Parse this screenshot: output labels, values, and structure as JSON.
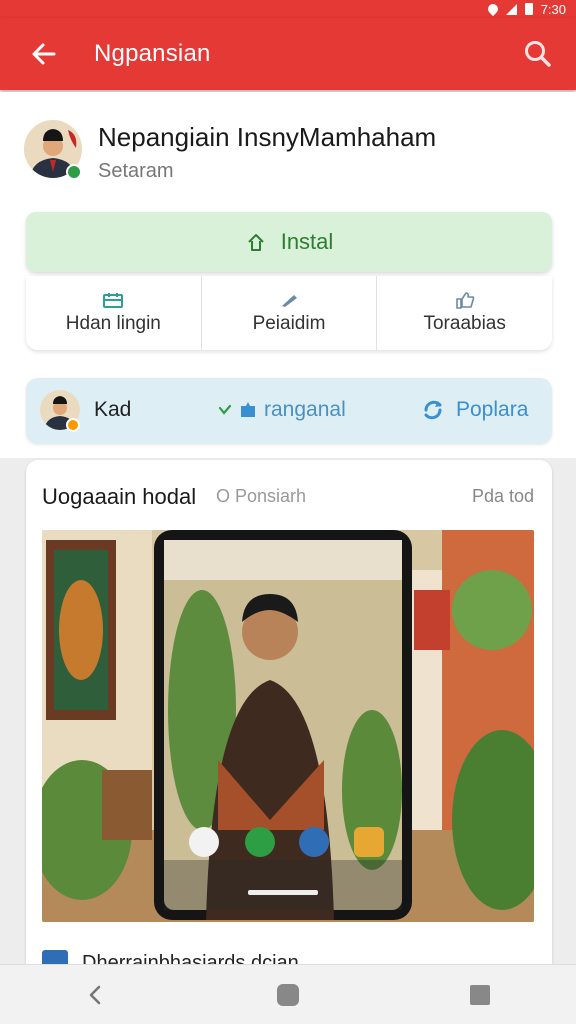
{
  "status_bar": {
    "time": "7:30"
  },
  "app_bar": {
    "title": "Ngpansian"
  },
  "app": {
    "name": "Nepangiain InsnyMamhaham",
    "subtitle": "Setaram"
  },
  "install": {
    "label": "Instal"
  },
  "actions": [
    {
      "label": "Hdan lingin",
      "icon": "calendar-icon"
    },
    {
      "label": "Peiaidim",
      "icon": "pen-icon"
    },
    {
      "label": "Toraabias",
      "icon": "thumbs-up-icon"
    }
  ],
  "info": {
    "label": "Kad",
    "ranking_label": "ranganal",
    "popular_label": "Poplara"
  },
  "preview": {
    "title": "Uogaaain hodal",
    "subtitle": "O Ponsiarh",
    "right_label": "Pda tod"
  },
  "bottom_item": {
    "label": "Dherrainbhasiards dcian"
  },
  "colors": {
    "accent": "#e53935",
    "install_bg": "#d9f0d9",
    "install_text": "#2e7d32",
    "info_bg": "#ddeff5",
    "link_blue": "#3a8fd0"
  }
}
